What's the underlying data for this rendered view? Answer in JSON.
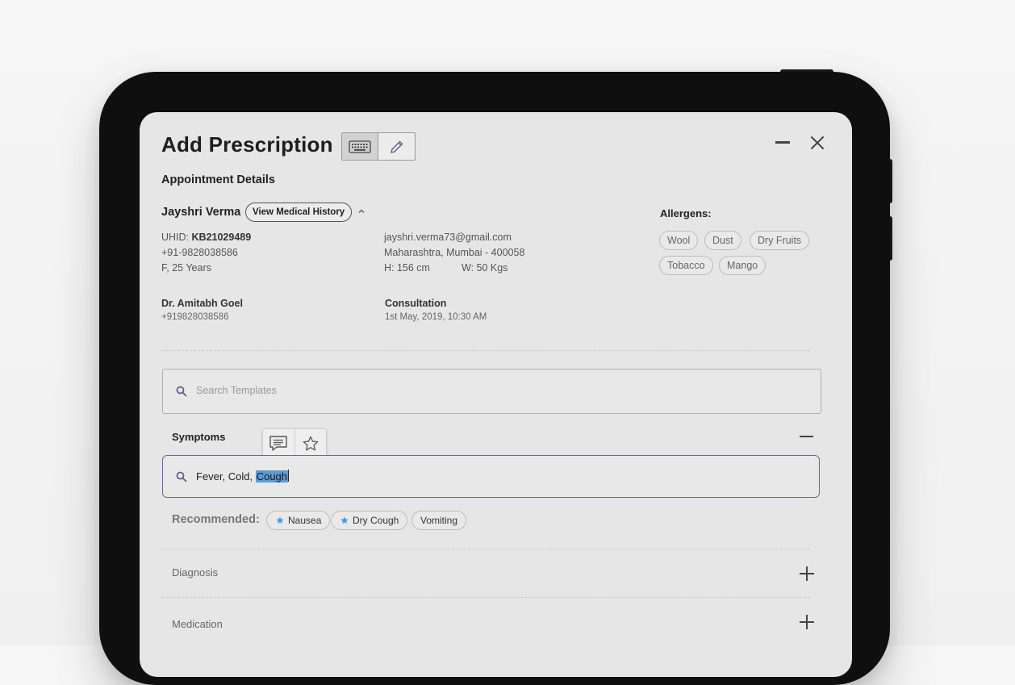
{
  "header": {
    "title": "Add Prescription",
    "mode_keyboard_icon": "keyboard-icon",
    "mode_pencil_icon": "pencil-icon"
  },
  "appointment": {
    "section_title": "Appointment Details",
    "patient": {
      "name": "Jayshri Verma",
      "view_history_label": "View Medical History",
      "uhid_label": "UHID:",
      "uhid_value": "KB21029489",
      "phone": "+91-9828038586",
      "gender_age": "F, 25 Years",
      "email": "jayshri.verma73@gmail.com",
      "address": "Maharashtra, Mumbai - 400058",
      "height": "H: 156 cm",
      "weight": "W: 50 Kgs"
    },
    "doctor": {
      "name": "Dr. Amitabh Goel",
      "phone": "+919828038586"
    },
    "consultation": {
      "label": "Consultation",
      "datetime": "1st May, 2019, 10:30 AM"
    },
    "allergens": {
      "title": "Allergens:",
      "items": [
        "Wool",
        "Dust",
        "Dry Fruits",
        "Tobacco",
        "Mango"
      ]
    }
  },
  "templates": {
    "search_placeholder": "Search Templates"
  },
  "symptoms": {
    "title": "Symptoms",
    "input_prefix": "Fever, Cold, ",
    "input_selected": "Cough",
    "recommended_label": "Recommended:",
    "recommended": [
      {
        "label": "Nausea",
        "starred": true
      },
      {
        "label": "Dry Cough",
        "starred": true
      },
      {
        "label": "Vomiting",
        "starred": false
      }
    ]
  },
  "sections": {
    "diagnosis": "Diagnosis",
    "medication": "Medication"
  },
  "colors": {
    "accent_purple": "#7a6090",
    "selection_blue": "#5b9bd5",
    "star_blue": "#4a9fd8"
  }
}
